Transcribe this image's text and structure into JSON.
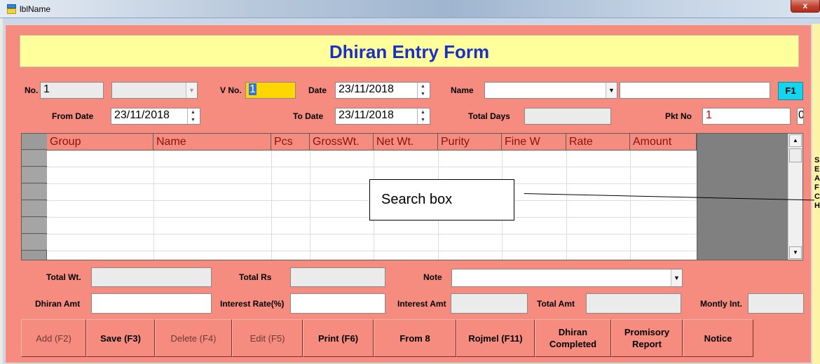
{
  "window": {
    "title": "lblName",
    "close_glyph": "x"
  },
  "banner": {
    "title": "Dhiran Entry Form"
  },
  "row1": {
    "no_label": "No.",
    "no_value": "1",
    "vno_label": "V No.",
    "vno_value": "1",
    "date_label": "Date",
    "date_value": "23/11/2018",
    "name_label": "Name",
    "name_value": "",
    "name_text": "",
    "f1_label": "F1"
  },
  "row2": {
    "from_date_label": "From Date",
    "from_date_value": "23/11/2018",
    "to_date_label": "To Date",
    "to_date_value": "23/11/2018",
    "total_days_label": "Total Days",
    "total_days_value": "",
    "pkt_no_label": "Pkt No",
    "pkt_no_value": "1",
    "extra_value": "0"
  },
  "grid": {
    "columns": [
      "Group",
      "Name",
      "Pcs",
      "GrossWt.",
      "Net Wt.",
      "Purity",
      "Fine W",
      "Rate",
      "Amount"
    ],
    "rows": []
  },
  "callout": {
    "text": "Search  box"
  },
  "side_letters": [
    "S",
    "E",
    "A",
    "F",
    "C",
    "H"
  ],
  "totals": {
    "total_wt_label": "Total Wt.",
    "total_wt_value": "",
    "total_rs_label": "Total Rs",
    "total_rs_value": "",
    "note_label": "Note",
    "note_value": "",
    "dhiran_amt_label": "Dhiran Amt",
    "dhiran_amt_value": "",
    "interest_rate_label": "Interest Rate(%)",
    "interest_rate_value": "",
    "interest_amt_label": "Interest Amt",
    "interest_amt_value": "",
    "total_amt_label": "Total Amt",
    "total_amt_value": "",
    "monthly_int_label": "Montly Int.",
    "monthly_int_value": ""
  },
  "buttons": {
    "add": "Add (F2)",
    "save": "Save (F3)",
    "delete": "Delete (F4)",
    "edit": "Edit (F5)",
    "print": "Print (F6)",
    "from8": "From 8",
    "rojmel": "Rojmel (F11)",
    "dhiran_completed_1": "Dhiran",
    "dhiran_completed_2": "Completed",
    "promisory_1": "Promisory",
    "promisory_2": "Report",
    "notice": "Notice"
  },
  "colors": {
    "form_bg": "#f68c7f",
    "banner_bg": "#ffff9c",
    "banner_text": "#1a2fc7",
    "vno_bg": "#ffd700",
    "f1_bg": "#14d5f0"
  },
  "icons": {
    "spin": "up-down-spinner-icon",
    "dropdown": "chevron-down-icon"
  }
}
